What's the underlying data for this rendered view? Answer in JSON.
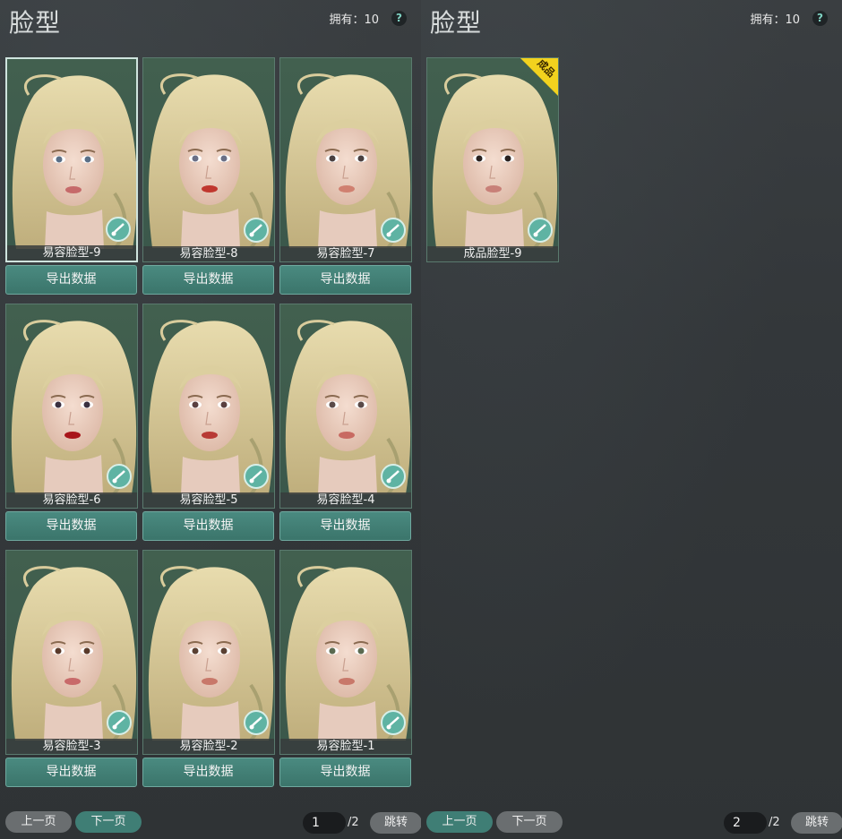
{
  "left": {
    "title": "脸型",
    "owned_label": "拥有：10",
    "help": "?",
    "cards": [
      {
        "label": "易容脸型-9",
        "export": "导出数据",
        "lip": "#c66a6a",
        "iris": "#5a6f86",
        "selected": true
      },
      {
        "label": "易容脸型-8",
        "export": "导出数据",
        "lip": "#c0372e",
        "iris": "#6a6f86"
      },
      {
        "label": "易容脸型-7",
        "export": "导出数据",
        "lip": "#d08070",
        "iris": "#4a4040"
      },
      {
        "label": "易容脸型-6",
        "export": "导出数据",
        "lip": "#a8151a",
        "iris": "#3a3040"
      },
      {
        "label": "易容脸型-5",
        "export": "导出数据",
        "lip": "#b83a35",
        "iris": "#5a4040"
      },
      {
        "label": "易容脸型-4",
        "export": "导出数据",
        "lip": "#c86a62",
        "iris": "#5a4a48"
      },
      {
        "label": "易容脸型-3",
        "export": "导出数据",
        "lip": "#c86a6a",
        "iris": "#5a3a2a"
      },
      {
        "label": "易容脸型-2",
        "export": "导出数据",
        "lip": "#c8786a",
        "iris": "#5a4032"
      },
      {
        "label": "易容脸型-1",
        "export": "导出数据",
        "lip": "#c8786a",
        "iris": "#5a6a50"
      }
    ],
    "prev": "上一页",
    "next": "下一页",
    "page": "1",
    "total": "/2",
    "jump": "跳转"
  },
  "right": {
    "title": "脸型",
    "owned_label": "拥有：10",
    "help": "?",
    "card": {
      "label": "成品脸型-9",
      "badge": "成品",
      "lip": "#c88078",
      "iris": "#2a2220"
    },
    "prev": "上一页",
    "next": "下一页",
    "page": "2",
    "total": "/2",
    "jump": "跳转"
  },
  "colors": {
    "accent": "#3f7e75",
    "badge": "#f2d21e"
  }
}
